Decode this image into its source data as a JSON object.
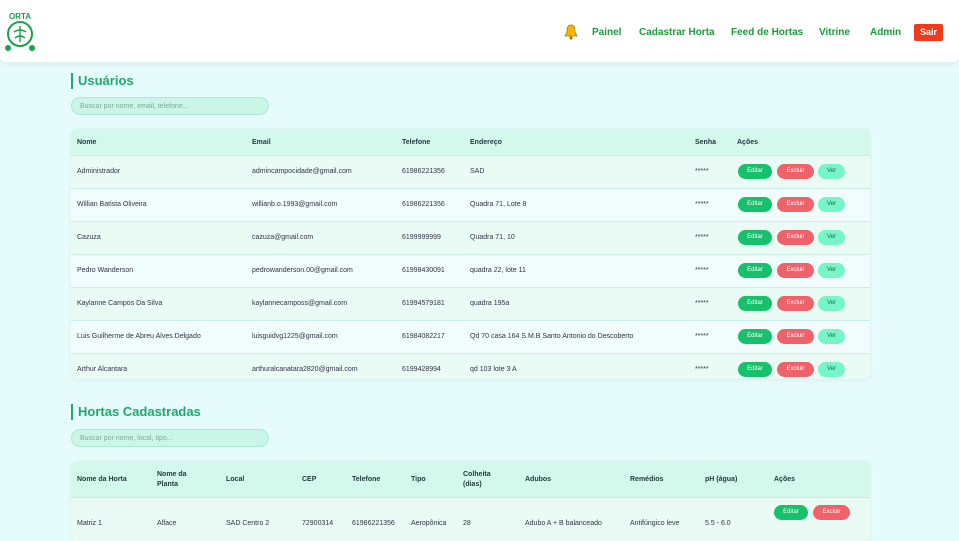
{
  "header": {
    "logo_text": "ORTA",
    "nav": [
      "Painel",
      "Cadastrar Horta",
      "Feed de Hortas",
      "Vitrine",
      "Admin"
    ],
    "logout_label": "Sair"
  },
  "users": {
    "title": "Usuários",
    "search_placeholder": "Buscar por nome, email, telefone...",
    "columns": [
      "Nome",
      "Email",
      "Telefone",
      "Endereço",
      "Senha",
      "Ações"
    ],
    "actions": {
      "edit": "Editar",
      "delete": "Excluir",
      "view": "Ver"
    },
    "rows": [
      {
        "nome": "Administrador",
        "email": "admincampocidade@gmail.com",
        "telefone": "61986221356",
        "endereco": "SAD",
        "senha": "*****"
      },
      {
        "nome": "Willian Batista Oliveira",
        "email": "willianb.o.1993@gmail.com",
        "telefone": "61986221356",
        "endereco": "Quadra 71, Lote 8",
        "senha": "*****"
      },
      {
        "nome": "Cazuza",
        "email": "cazuza@gmail.com",
        "telefone": "6199999999",
        "endereco": "Quadra 71, 10",
        "senha": "*****"
      },
      {
        "nome": "Pedro Wanderson",
        "email": "pedrowanderson.00@gmail.com",
        "telefone": "61998430091",
        "endereco": "quadra 22, lote 11",
        "senha": "*****"
      },
      {
        "nome": "Kaylanne Campos Da Silva",
        "email": "kaylannecamposs@gmail.com",
        "telefone": "61994579181",
        "endereco": "quadra 195a",
        "senha": "*****"
      },
      {
        "nome": "Luis Guilherme de Abreu Alves Delgado",
        "email": "luisguidvg1225@gmail.com",
        "telefone": "61984082217",
        "endereco": "Qd 70 casa 164 S.M.B Santo Antonio do Descoberto",
        "senha": "*****"
      },
      {
        "nome": "Arthur Alcantara",
        "email": "arthuralcanatara2820@gmail.com",
        "telefone": "6199428994",
        "endereco": "qd 103 lote 3 A",
        "senha": "*****"
      }
    ]
  },
  "hortas": {
    "title": "Hortas Cadastradas",
    "search_placeholder": "Buscar por nome, local, tipo...",
    "columns": [
      "Nome da Horta",
      "Nome da Planta",
      "Local",
      "CEP",
      "Telefone",
      "Tipo",
      "Colheita (dias)",
      "Adubos",
      "Remédios",
      "pH (água)",
      "Ações"
    ],
    "actions": {
      "edit": "Editar",
      "delete": "Excluir"
    },
    "rows": [
      {
        "nome": "Matriz 1",
        "planta": "Alface",
        "local": "SAD Centro 2",
        "cep": "72900314",
        "telefone": "61986221356",
        "tipo": "Aeropônica",
        "colheita": "28",
        "adubos": "Adubo A + B balanceado",
        "remedios": "Antifúngico leve",
        "ph": "5.5 - 6.0"
      }
    ]
  },
  "colors": {
    "accent": "#1faa6b",
    "nav": "#1a9d3a",
    "logout": "#ef3b19",
    "edit": "#17c06a",
    "delete": "#f0626a",
    "view": "#76f5c9"
  }
}
